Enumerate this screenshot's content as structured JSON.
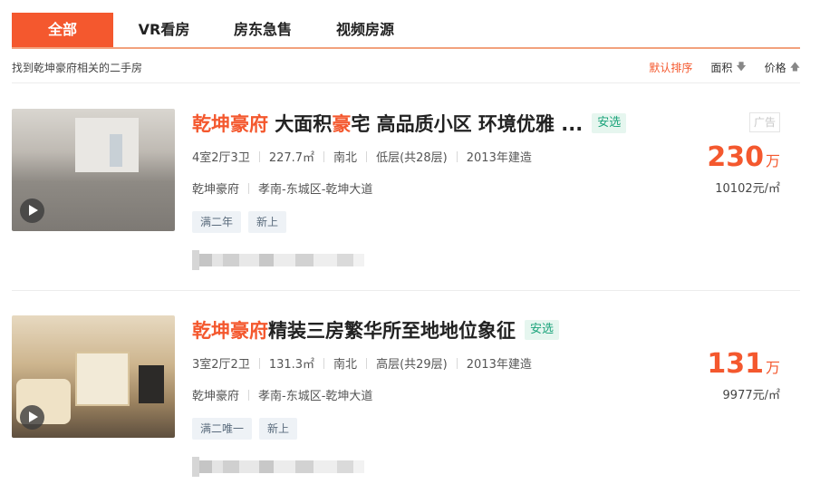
{
  "tabs": [
    {
      "label": "全部",
      "active": true
    },
    {
      "label": "VR看房",
      "active": false
    },
    {
      "label": "房东急售",
      "active": false
    },
    {
      "label": "视频房源",
      "active": false
    }
  ],
  "summary": "找到乾坤豪府相关的二手房",
  "sorts": {
    "default": "默认排序",
    "area": "面积",
    "price": "价格"
  },
  "listings": [
    {
      "title_hl": "乾坤豪府",
      "title_mid": " 大面积",
      "title_hl2": "豪",
      "title_rest": "宅 高品质小区 环境优雅 ...",
      "badge": "安选",
      "ad": "广告",
      "layout": "4室2厅3卫",
      "area": "227.7㎡",
      "orientation": "南北",
      "floor": "低层(共28层)",
      "year": "2013年建造",
      "community": "乾坤豪府",
      "location": "孝南-东城区-乾坤大道",
      "tags": [
        "满二年",
        "新上"
      ],
      "price_num": "230",
      "price_unit": "万",
      "unit_price": "10102元/㎡"
    },
    {
      "title_hl": "乾坤豪府",
      "title_mid": "精装三房繁华所至地地位象征",
      "title_hl2": "",
      "title_rest": "",
      "badge": "安选",
      "layout": "3室2厅2卫",
      "area": "131.3㎡",
      "orientation": "南北",
      "floor": "高层(共29层)",
      "year": "2013年建造",
      "community": "乾坤豪府",
      "location": "孝南-东城区-乾坤大道",
      "tags": [
        "满二唯一",
        "新上"
      ],
      "price_num": "131",
      "price_unit": "万",
      "unit_price": "9977元/㎡"
    }
  ],
  "colors": {
    "accent": "#f4582e",
    "badge_green": "#1aa37a"
  },
  "icons": {
    "play": "play-icon",
    "arrow_down": "arrow-down-icon",
    "arrow_up": "arrow-up-icon"
  }
}
